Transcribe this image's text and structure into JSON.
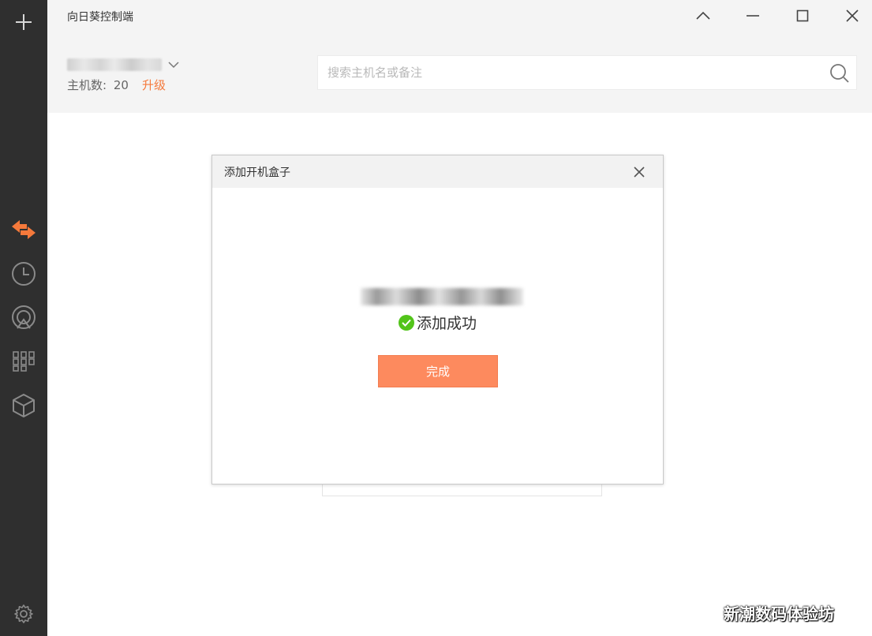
{
  "app": {
    "title": "向日葵控制端"
  },
  "sidebar": {
    "items": [
      {
        "icon": "add-icon",
        "active": false
      },
      {
        "icon": "remote-control-icon",
        "active": true
      },
      {
        "icon": "history-icon",
        "active": false
      },
      {
        "icon": "discovery-icon",
        "active": false
      },
      {
        "icon": "apps-icon",
        "active": false
      },
      {
        "icon": "box-icon",
        "active": false
      },
      {
        "icon": "settings-icon",
        "active": false
      }
    ]
  },
  "header": {
    "host_count_label": "主机数:",
    "host_count": "20",
    "upgrade_label": "升级"
  },
  "search": {
    "placeholder": "搜索主机名或备注"
  },
  "dialog": {
    "title": "添加开机盒子",
    "success_text": "添加成功",
    "done_label": "完成"
  },
  "watermark": "新潮数码体验坊",
  "colors": {
    "accent": "#f5793b",
    "button": "#fd8a5e",
    "sidebar_bg": "#2f2f2f",
    "success": "#52c41a"
  }
}
